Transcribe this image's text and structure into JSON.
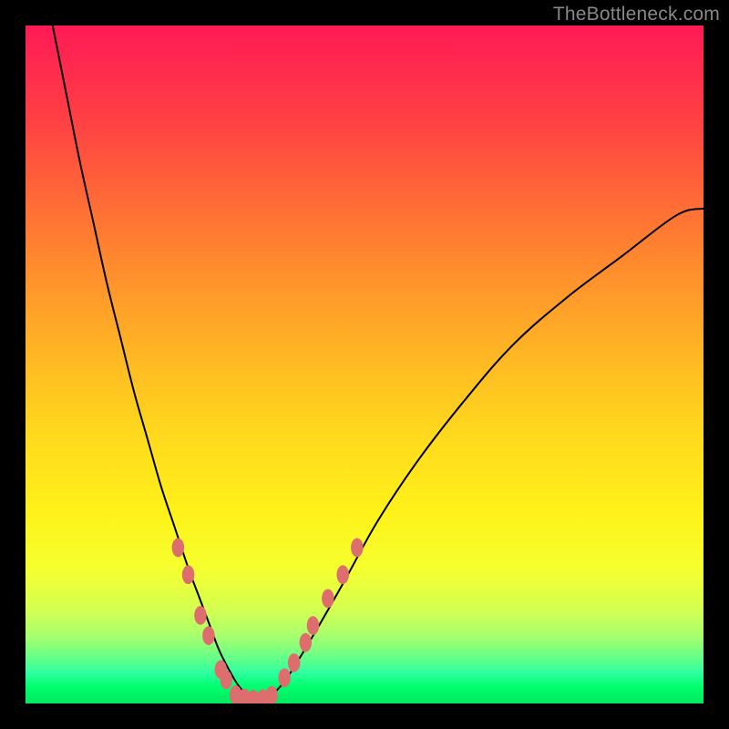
{
  "watermark": "TheBottleneck.com",
  "chart_data": {
    "type": "line",
    "title": "",
    "xlabel": "",
    "ylabel": "",
    "xlim": [
      0,
      100
    ],
    "ylim": [
      0,
      100
    ],
    "grid": false,
    "legend": false,
    "background": {
      "type": "vertical-gradient",
      "stops": [
        {
          "pos": 0,
          "color": "#ff1a55"
        },
        {
          "pos": 0.25,
          "color": "#ff6a36"
        },
        {
          "pos": 0.55,
          "color": "#ffd81d"
        },
        {
          "pos": 0.8,
          "color": "#f5ff2e"
        },
        {
          "pos": 0.95,
          "color": "#2dffa0"
        },
        {
          "pos": 1.0,
          "color": "#00e85f"
        }
      ]
    },
    "series": [
      {
        "name": "bottleneck-curve",
        "color": "#000000",
        "x": [
          4,
          6,
          8,
          10,
          12,
          14,
          16,
          18,
          20,
          22,
          24,
          25.5,
          27,
          28.5,
          30,
          31.5,
          33,
          34.5,
          36,
          38,
          40,
          43,
          47,
          52,
          58,
          65,
          72,
          80,
          88,
          96,
          100
        ],
        "y": [
          100,
          90,
          80,
          71,
          62,
          54,
          46,
          39,
          32,
          26,
          20,
          16,
          12,
          8,
          5,
          2.5,
          1,
          0.5,
          1,
          3,
          6,
          11,
          18,
          27,
          36,
          45,
          53,
          60,
          66,
          72,
          73
        ]
      }
    ],
    "markers": {
      "name": "highlight-dots",
      "color": "#de6e6e",
      "radius": 9,
      "points": [
        {
          "x": 22.5,
          "y": 23
        },
        {
          "x": 24.0,
          "y": 19
        },
        {
          "x": 25.8,
          "y": 13
        },
        {
          "x": 27.0,
          "y": 10
        },
        {
          "x": 28.8,
          "y": 5
        },
        {
          "x": 29.6,
          "y": 3.5
        },
        {
          "x": 31.0,
          "y": 1.3
        },
        {
          "x": 32.3,
          "y": 0.8
        },
        {
          "x": 33.6,
          "y": 0.6
        },
        {
          "x": 35.0,
          "y": 0.7
        },
        {
          "x": 36.3,
          "y": 1.2
        },
        {
          "x": 38.2,
          "y": 3.8
        },
        {
          "x": 39.6,
          "y": 6.0
        },
        {
          "x": 41.3,
          "y": 9.0
        },
        {
          "x": 42.4,
          "y": 11.5
        },
        {
          "x": 44.6,
          "y": 15.5
        },
        {
          "x": 46.8,
          "y": 19.0
        },
        {
          "x": 48.9,
          "y": 23.0
        }
      ]
    }
  }
}
